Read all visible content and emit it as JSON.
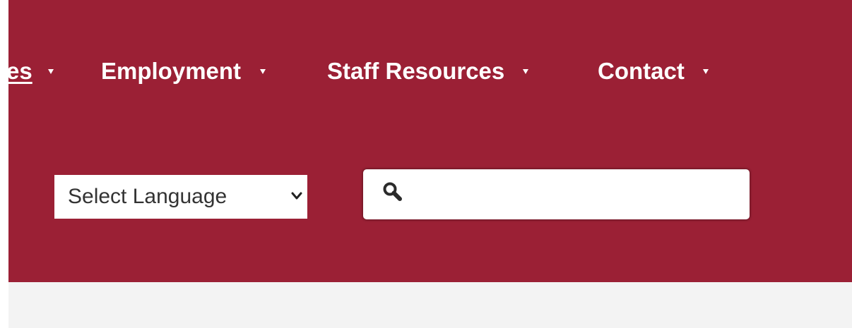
{
  "nav": {
    "items": [
      {
        "label": "es",
        "active": true
      },
      {
        "label": "Employment"
      },
      {
        "label": "Staff Resources"
      },
      {
        "label": "Contact"
      }
    ]
  },
  "language": {
    "selected": "Select Language",
    "icon": "chevron-down-icon"
  },
  "search": {
    "value": "",
    "icon": "search-icon"
  },
  "colors": {
    "brand": "#9b2035",
    "footer_band": "#f3f3f3",
    "text_light": "#ffffff"
  }
}
